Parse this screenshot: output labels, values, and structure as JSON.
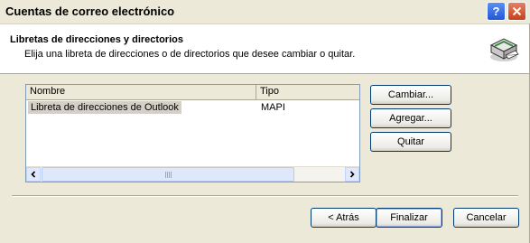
{
  "window": {
    "title": "Cuentas de correo electrónico",
    "help_label": "?",
    "close_icon": "close-icon"
  },
  "header": {
    "title": "Libretas de direcciones y directorios",
    "subtitle": "Elija una libreta de direcciones o de directorios que desee cambiar o quitar.",
    "icon": "address-book-icon"
  },
  "list": {
    "columns": [
      "Nombre",
      "Tipo"
    ],
    "rows": [
      {
        "name": "Libreta de direcciones de Outlook",
        "type": "MAPI",
        "selected": true
      }
    ]
  },
  "side_buttons": {
    "change": "Cambiar...",
    "add": "Agregar...",
    "remove": "Quitar"
  },
  "footer": {
    "back": "< Atrás",
    "finish": "Finalizar",
    "cancel": "Cancelar"
  },
  "colors": {
    "dialog_bg": "#ece9d8",
    "selection_bg": "#d4d0c8",
    "button_border": "#003c74"
  }
}
